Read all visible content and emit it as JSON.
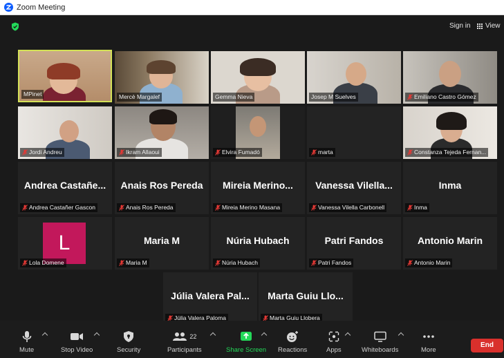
{
  "window": {
    "title": "Zoom Meeting"
  },
  "header": {
    "sign_in": "Sign in",
    "view": "View"
  },
  "tiles": [
    {
      "name": "MPinet"
    },
    {
      "name": "Mercè Margalef"
    },
    {
      "name": "Gemma Nieva"
    },
    {
      "name": "Josep M Suelves"
    },
    {
      "name": "Emiliano Castro Gómez"
    },
    {
      "name": "Jordi Andreu"
    },
    {
      "name": "Ikram Allaoui"
    },
    {
      "name": "Elvira Fumadó"
    },
    {
      "name": "marta"
    },
    {
      "name": "Constanza Tejeda Fernan..."
    },
    {
      "display": "Andrea  Castañe...",
      "name": "Andrea Castañer Gascon"
    },
    {
      "display": "Anais Ros Pereda",
      "name": "Anais Ros Pereda"
    },
    {
      "display": "Mireia  Merino...",
      "name": "Mireia Merino Masana"
    },
    {
      "display": "Vanessa  Vilella...",
      "name": "Vanessa Vilella Carbonell"
    },
    {
      "display": "Inma",
      "name": "Inma"
    },
    {
      "initial": "L",
      "name": "Lola Domene"
    },
    {
      "display": "Maria M",
      "name": "Maria M"
    },
    {
      "display": "Núria Hubach",
      "name": "Núria Hubach"
    },
    {
      "display": "Patri Fandos",
      "name": "Patri Fandos"
    },
    {
      "display": "Antonio Marin",
      "name": "Antonio Marin"
    },
    {
      "display": "Júlia  Valera  Pal...",
      "name": "Júlia Valera Paloma"
    },
    {
      "display": "Marta  Guiu  Llo...",
      "name": "Marta Guiu Llobera"
    }
  ],
  "toolbar": {
    "mute": "Mute",
    "stop_video": "Stop Video",
    "security": "Security",
    "participants": "Participants",
    "participants_count": "22",
    "share_screen": "Share Screen",
    "reactions": "Reactions",
    "apps": "Apps",
    "whiteboards": "Whiteboards",
    "more": "More",
    "end": "End"
  },
  "colors": {
    "accent_green": "#23d959",
    "end_red": "#d9302c",
    "active_speaker": "#d4e157",
    "avatar_bg": "#c2185b"
  }
}
